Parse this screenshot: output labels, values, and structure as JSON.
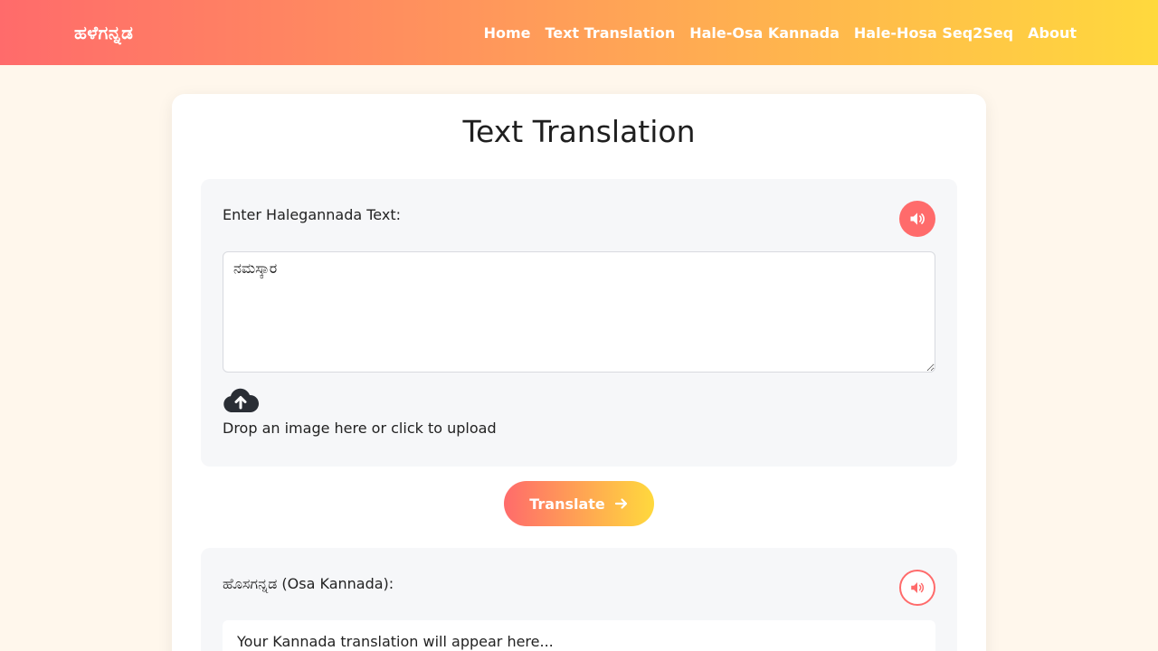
{
  "nav": {
    "brand": "ಹಳೆಗನ್ನಡ",
    "links": [
      "Home",
      "Text Translation",
      "Hale-Osa Kannada",
      "Hale-Hosa Seq2Seq",
      "About"
    ]
  },
  "page": {
    "title": "Text Translation"
  },
  "input_panel": {
    "label": "Enter Halegannada Text:",
    "text_value": "ನಮಸ್ಕಾರ",
    "upload_text": "Drop an image here or click to upload",
    "speak_icon": "volume-icon"
  },
  "translate_button": {
    "label": "Translate",
    "icon": "arrow-right-icon"
  },
  "output_panel": {
    "label": "ಹೊಸಗನ್ನಡ (Osa Kannada):",
    "placeholder": "Your Kannada translation will appear here...",
    "speak_icon": "volume-icon"
  },
  "colors": {
    "accent": "#ff6b6b",
    "gradient_end": "#ffd93d",
    "background": "#fff7ec",
    "panel": "#f6f7f9"
  }
}
